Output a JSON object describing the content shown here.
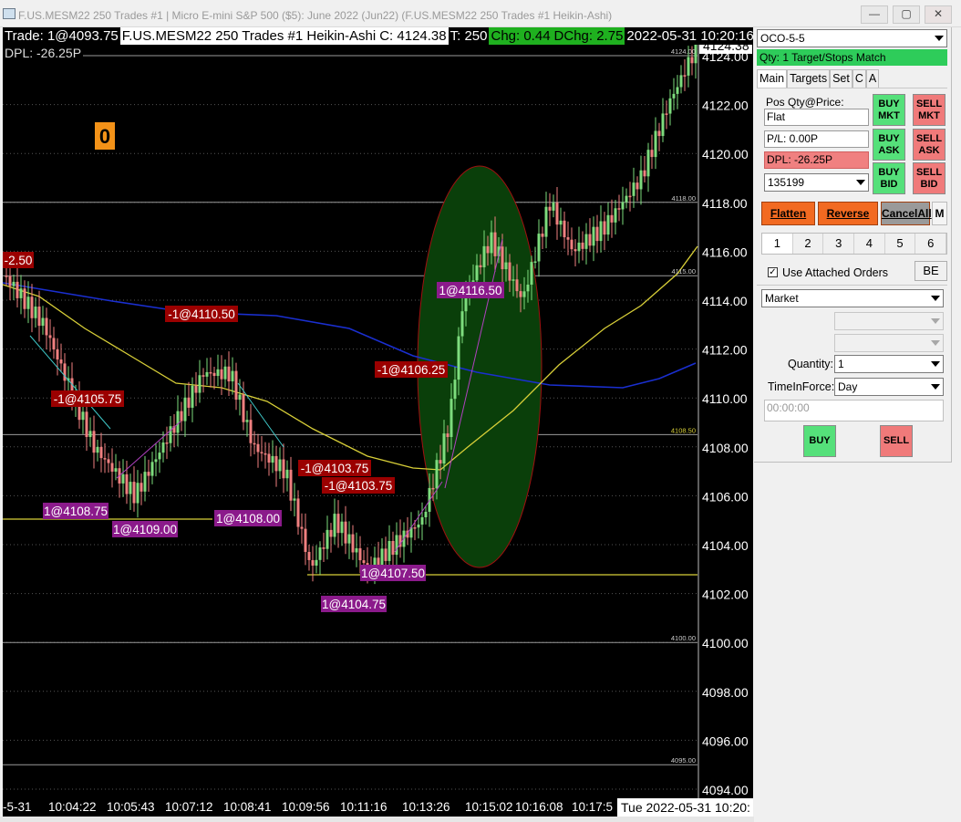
{
  "window": {
    "title": "F.US.MESM22  250 Trades  #1 | Micro E-mini S&P 500 ($5): June 2022 (Jun22) (F.US.MESM22  250 Trades  #1 Heikin-Ashi)",
    "min_icon": "minimize-icon",
    "max_icon": "maximize-icon",
    "close_icon": "close-icon",
    "min_glyph": "—",
    "max_glyph": "▢",
    "close_glyph": "✕"
  },
  "chart": {
    "info": {
      "trade": "Trade: 1@4093.75",
      "symbol": "F.US.MESM22  250 Trades  #1 Heikin-Ashi",
      "close": "C: 4124.38",
      "ticks": "T: 250",
      "chg": "Chg: 0.44",
      "dchg": "DChg: 2.75",
      "datetime": "2022-05-31  10:20:16"
    },
    "dpl": "DPL: -26.25P",
    "counter": "0",
    "price_axis": [
      "4124.00",
      "4122.00",
      "4120.00",
      "4118.00",
      "4116.00",
      "4114.00",
      "4112.00",
      "4110.00",
      "4108.00",
      "4106.00",
      "4104.00",
      "4102.00",
      "4100.00",
      "4098.00",
      "4096.00",
      "4094.00"
    ],
    "price_top_partial": "4125.29",
    "current_price": "4124.38",
    "level_tags": [
      "4124.00",
      "4118.00",
      "4115.00",
      "4108.50",
      "4100.00",
      "4095.00"
    ],
    "trade_labels": {
      "sell": [
        "-2.50",
        "-1@4110.50",
        "-1@4105.75",
        "-1@4106.25",
        "-1@4103.75",
        "-1@4103.75"
      ],
      "buy": [
        "1@4108.75",
        "1@4109.00",
        "1@4108.00",
        "1@4107.50",
        "1@4104.75",
        "1@4116.50"
      ]
    },
    "time_axis": [
      "-5-31",
      "10:04:22",
      "10:05:43",
      "10:07:12",
      "10:08:41",
      "10:09:56",
      "10:11:16",
      "10:13:26",
      "10:15:02",
      "10:16:08",
      "10:17:5"
    ],
    "time_cursor": "Tue 2022-05-31  10:20:",
    "colors": {
      "bull": "#7ddc7d",
      "bear": "#f08080",
      "ma_slow": "#1a2fd0",
      "ma_fast": "#d8cf38",
      "sell_label": "#9b0000",
      "buy_label": "#8b1a8b",
      "ellipse": "#0a3f0a"
    }
  },
  "panel": {
    "strategy": "OCO-5-5",
    "qty_match": "Qty: 1 Target/Stops Match",
    "tabs": [
      "Main",
      "Targets",
      "Set",
      "C",
      "A"
    ],
    "pos_label": "Pos Qty@Price:",
    "pos_value": "Flat",
    "pl": "P/L: 0.00P",
    "dpl": "DPL: -26.25P",
    "account": "135199",
    "buy_mkt": "BUY MKT",
    "sell_mkt": "SELL MKT",
    "buy_ask": "BUY ASK",
    "sell_ask": "SELL ASK",
    "buy_bid": "BUY BID",
    "sell_bid": "SELL BID",
    "flatten": "Flatten",
    "reverse": "Reverse",
    "cancel_all": "CancelAll",
    "m": "M",
    "num_tabs": [
      "1",
      "2",
      "3",
      "4",
      "5",
      "6"
    ],
    "use_attached": "Use Attached Orders",
    "be": "BE",
    "order_type": "Market",
    "quantity_label": "Quantity:",
    "quantity": "1",
    "tif_label": "TimeInForce:",
    "tif": "Day",
    "time_field": "00:00:00",
    "buy": "BUY",
    "sell": "SELL"
  }
}
